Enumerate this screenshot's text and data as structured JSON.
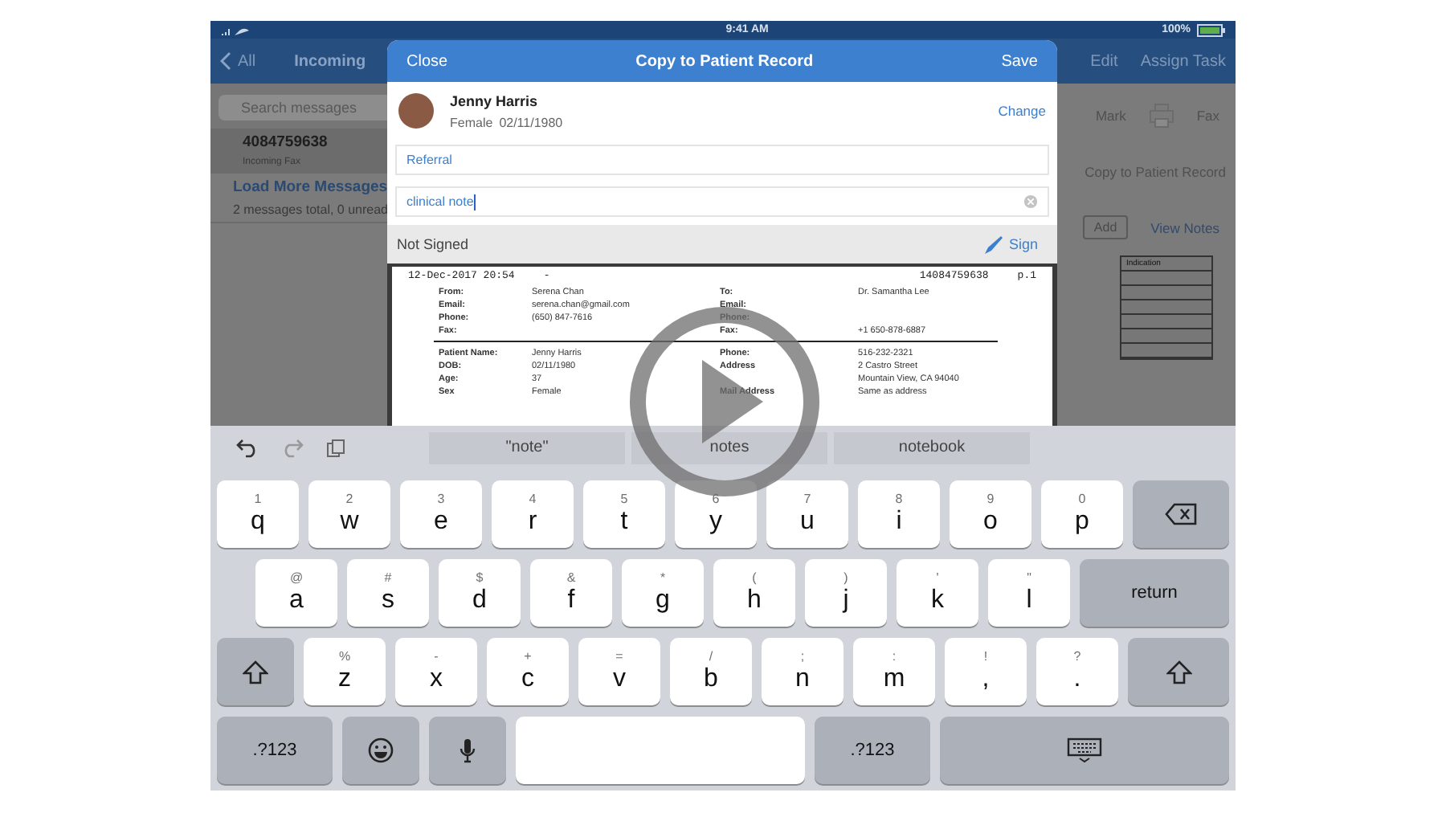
{
  "status_bar": {
    "time": "9:41 AM",
    "battery": "100%"
  },
  "nav_bar": {
    "back": "All",
    "title": "Incoming",
    "actions": [
      "Edit",
      "Assign Task"
    ]
  },
  "sidebar": {
    "search": {
      "placeholder": "Search messages"
    },
    "items": [
      {
        "title": "4084759638",
        "subtitle": "Incoming Fax",
        "kind": "message",
        "selected": true
      },
      {
        "title": "Load More Messages",
        "subtitle": "2 messages total, 0 unread",
        "kind": "load",
        "selected": false
      }
    ]
  },
  "detail": {
    "toolbar": [
      "Mark",
      "Fax"
    ],
    "copy_action": "Copy to Patient Record",
    "add": "Add",
    "view_notes": "View Notes",
    "table_header": "Indication"
  },
  "modal": {
    "close": "Close",
    "title": "Copy to Patient Record",
    "save": "Save",
    "patient": {
      "name": "Jenny Harris",
      "sex": "Female",
      "dob": "02/11/1980",
      "change": "Change"
    },
    "fields": [
      {
        "value": "Referral",
        "clear": false
      },
      {
        "value": "clinical note",
        "clear": true
      }
    ],
    "signature": {
      "status": "Not Signed",
      "action": "Sign"
    },
    "document": {
      "header": [
        "12-Dec-2017  20:54",
        "-",
        "14084759638",
        "p.1"
      ],
      "sender": [
        {
          "left_label": "From:",
          "left_value": "Serena Chan",
          "right_label": "To:",
          "right_value": "Dr. Samantha Lee"
        },
        {
          "left_label": "Email:",
          "left_value": "serena.chan@gmail.com",
          "right_label": "Email:"
        },
        {
          "left_label": "Phone:",
          "left_value": "(650) 847-7616",
          "right_label": "Phone:"
        },
        {
          "left_label": "Fax:",
          "right_label": "Fax:",
          "right_value": "+1 650-878-6887"
        }
      ],
      "patient": [
        {
          "left_label": "Patient Name:",
          "left_value": "Jenny Harris",
          "right_label": "Phone:",
          "right_value": "516-232-2321"
        },
        {
          "left_label": "DOB:",
          "left_value": "02/11/1980",
          "right_label": "Address",
          "right_value": "2 Castro Street"
        },
        {
          "left_label": "Age:",
          "left_value": "37",
          "right_value": "Mountain View, CA 94040"
        },
        {
          "left_label": "Sex",
          "left_value": "Female",
          "right_label": "Mail Address",
          "right_value": "Same as address"
        }
      ]
    }
  },
  "keyboard": {
    "suggestions": [
      "\"note\"",
      "notes",
      "notebook"
    ],
    "rows": [
      [
        {
          "kind": "letter",
          "label": "q",
          "hint": "1"
        },
        {
          "kind": "letter",
          "label": "w",
          "hint": "2"
        },
        {
          "kind": "letter",
          "label": "e",
          "hint": "3"
        },
        {
          "kind": "letter",
          "label": "r",
          "hint": "4"
        },
        {
          "kind": "letter",
          "label": "t",
          "hint": "5"
        },
        {
          "kind": "letter",
          "label": "y",
          "hint": "6"
        },
        {
          "kind": "letter",
          "label": "u",
          "hint": "7"
        },
        {
          "kind": "letter",
          "label": "i",
          "hint": "8"
        },
        {
          "kind": "letter",
          "label": "o",
          "hint": "9"
        },
        {
          "kind": "letter",
          "label": "p",
          "hint": "0"
        },
        {
          "kind": "backspace"
        }
      ],
      [
        {
          "kind": "letter",
          "label": "a",
          "hint": "@"
        },
        {
          "kind": "letter",
          "label": "s",
          "hint": "#"
        },
        {
          "kind": "letter",
          "label": "d",
          "hint": "$"
        },
        {
          "kind": "letter",
          "label": "f",
          "hint": "&"
        },
        {
          "kind": "letter",
          "label": "g",
          "hint": "*"
        },
        {
          "kind": "letter",
          "label": "h",
          "hint": "("
        },
        {
          "kind": "letter",
          "label": "j",
          "hint": ")"
        },
        {
          "kind": "letter",
          "label": "k",
          "hint": "'"
        },
        {
          "kind": "letter",
          "label": "l",
          "hint": "\""
        },
        {
          "kind": "return",
          "label": "return"
        }
      ],
      [
        {
          "kind": "shift"
        },
        {
          "kind": "letter",
          "label": "z",
          "hint": "%"
        },
        {
          "kind": "letter",
          "label": "x",
          "hint": "-"
        },
        {
          "kind": "letter",
          "label": "c",
          "hint": "+"
        },
        {
          "kind": "letter",
          "label": "v",
          "hint": "="
        },
        {
          "kind": "letter",
          "label": "b",
          "hint": "/"
        },
        {
          "kind": "letter",
          "label": "n",
          "hint": ";"
        },
        {
          "kind": "letter",
          "label": "m",
          "hint": ":"
        },
        {
          "kind": "letter",
          "label": ",",
          "hint": "!"
        },
        {
          "kind": "letter",
          "label": ".",
          "hint": "?"
        },
        {
          "kind": "shift"
        }
      ],
      [
        {
          "kind": "numbers",
          "label": ".?123"
        },
        {
          "kind": "emoji"
        },
        {
          "kind": "mic"
        },
        {
          "kind": "space"
        },
        {
          "kind": "numbers",
          "label": ".?123"
        },
        {
          "kind": "hide"
        }
      ]
    ]
  }
}
